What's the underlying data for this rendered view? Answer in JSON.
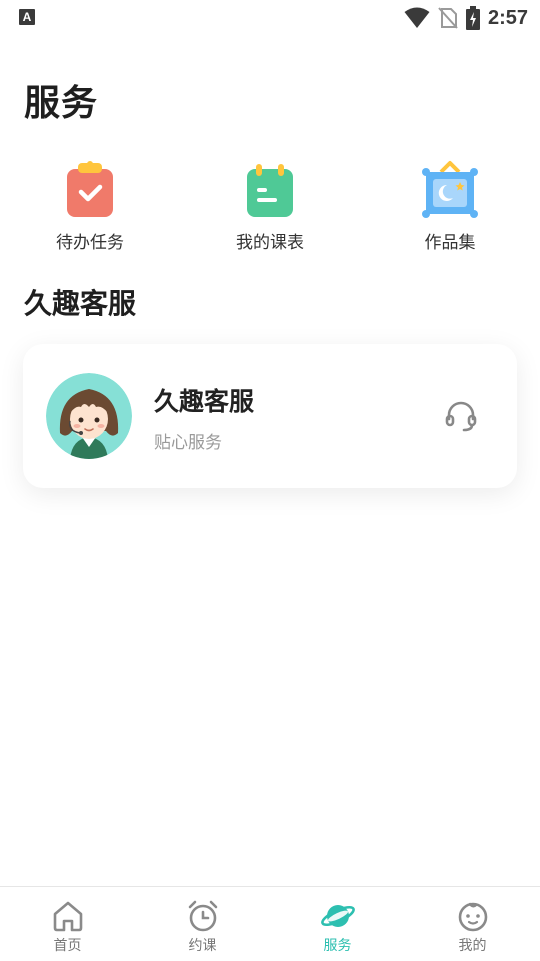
{
  "status_bar": {
    "time": "2:57",
    "notification_icon": "A"
  },
  "page_title": "服务",
  "quick_actions": [
    {
      "label": "待办任务",
      "icon": "clipboard-check-icon",
      "color": "#f07a6a"
    },
    {
      "label": "我的课表",
      "icon": "calendar-icon",
      "color": "#4fc996"
    },
    {
      "label": "作品集",
      "icon": "picture-frame-icon",
      "color": "#5fb3f5"
    }
  ],
  "section_title": "久趣客服",
  "customer_service": {
    "name": "久趣客服",
    "subtitle": "贴心服务",
    "avatar_bg": "#86e0d6",
    "icon": "headset-icon"
  },
  "tabbar": {
    "active_color": "#2dbfb0",
    "items": [
      {
        "label": "首页",
        "icon": "home-icon",
        "active": false
      },
      {
        "label": "约课",
        "icon": "alarm-clock-icon",
        "active": false
      },
      {
        "label": "服务",
        "icon": "planet-icon",
        "active": true
      },
      {
        "label": "我的",
        "icon": "baby-face-icon",
        "active": false
      }
    ]
  }
}
